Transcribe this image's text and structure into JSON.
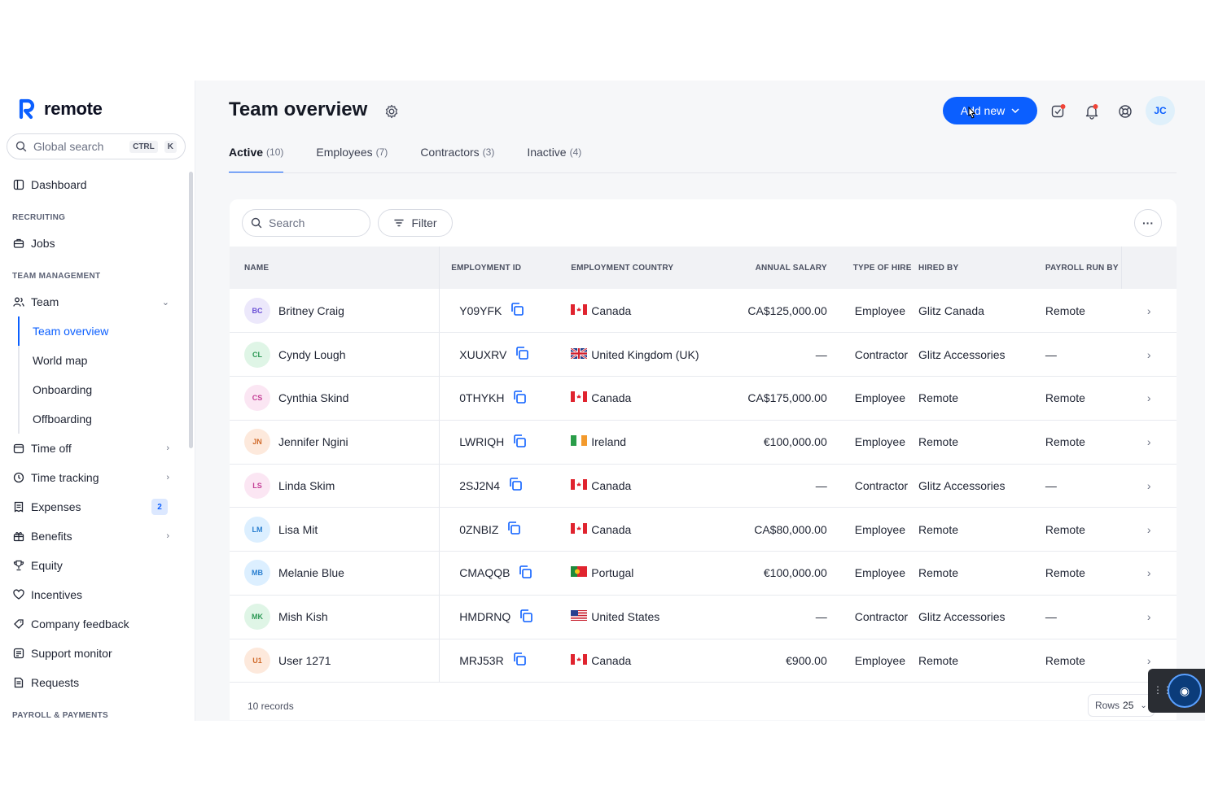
{
  "brand": {
    "name": "remote"
  },
  "global_search": {
    "placeholder": "Global search",
    "shortcut_ctrl": "CTRL",
    "shortcut_key": "K"
  },
  "sidebar": {
    "dashboard": "Dashboard",
    "section_recruiting": "RECRUITING",
    "jobs": "Jobs",
    "section_team": "TEAM MANAGEMENT",
    "team": "Team",
    "team_sub": [
      "Team overview",
      "World map",
      "Onboarding",
      "Offboarding"
    ],
    "time_off": "Time off",
    "time_tracking": "Time tracking",
    "expenses": "Expenses",
    "expenses_badge": "2",
    "benefits": "Benefits",
    "equity": "Equity",
    "incentives": "Incentives",
    "company_feedback": "Company feedback",
    "support_monitor": "Support monitor",
    "requests": "Requests",
    "section_payroll": "PAYROLL & PAYMENTS"
  },
  "header": {
    "title": "Team overview",
    "add_new": "Add new",
    "user_initials": "JC"
  },
  "tabs": [
    {
      "label": "Active",
      "count": "(10)"
    },
    {
      "label": "Employees",
      "count": "(7)"
    },
    {
      "label": "Contractors",
      "count": "(3)"
    },
    {
      "label": "Inactive",
      "count": "(4)"
    }
  ],
  "toolbar": {
    "search_placeholder": "Search",
    "filter_label": "Filter",
    "more_label": "···"
  },
  "table": {
    "headers": [
      "NAME",
      "EMPLOYMENT ID",
      "EMPLOYMENT COUNTRY",
      "ANNUAL SALARY",
      "TYPE OF HIRE",
      "HIRED BY",
      "PAYROLL RUN BY"
    ],
    "rows": [
      {
        "initials": "BC",
        "name": "Britney Craig",
        "id": "Y09YFK",
        "country": "Canada",
        "flag": "ca",
        "salary": "CA$125,000.00",
        "type": "Employee",
        "hired_by": "Glitz Canada",
        "payroll": "Remote",
        "av_bg": "#ece8fb",
        "av_fg": "#6a4fd6"
      },
      {
        "initials": "CL",
        "name": "Cyndy Lough",
        "id": "XUUXRV",
        "country": "United Kingdom (UK)",
        "flag": "uk",
        "salary": "—",
        "type": "Contractor",
        "hired_by": "Glitz Accessories",
        "payroll": "—",
        "av_bg": "#dff5e6",
        "av_fg": "#2f9a57"
      },
      {
        "initials": "CS",
        "name": "Cynthia Skind",
        "id": "0THYKH",
        "country": "Canada",
        "flag": "ca",
        "salary": "CA$175,000.00",
        "type": "Employee",
        "hired_by": "Remote",
        "payroll": "Remote",
        "av_bg": "#fbe6f3",
        "av_fg": "#c43f96"
      },
      {
        "initials": "JN",
        "name": "Jennifer Ngini",
        "id": "LWRIQH",
        "country": "Ireland",
        "flag": "ie",
        "salary": "€100,000.00",
        "type": "Employee",
        "hired_by": "Remote",
        "payroll": "Remote",
        "av_bg": "#fde9dc",
        "av_fg": "#d06a2a"
      },
      {
        "initials": "LS",
        "name": "Linda Skim",
        "id": "2SJ2N4",
        "country": "Canada",
        "flag": "ca",
        "salary": "—",
        "type": "Contractor",
        "hired_by": "Glitz Accessories",
        "payroll": "—",
        "av_bg": "#fbe6f3",
        "av_fg": "#c43f96"
      },
      {
        "initials": "LM",
        "name": "Lisa Mit",
        "id": "0ZNBIZ",
        "country": "Canada",
        "flag": "ca",
        "salary": "CA$80,000.00",
        "type": "Employee",
        "hired_by": "Remote",
        "payroll": "Remote",
        "av_bg": "#dcefff",
        "av_fg": "#2a7fd0"
      },
      {
        "initials": "MB",
        "name": "Melanie Blue",
        "id": "CMAQQB",
        "country": "Portugal",
        "flag": "pt",
        "salary": "€100,000.00",
        "type": "Employee",
        "hired_by": "Remote",
        "payroll": "Remote",
        "av_bg": "#dcefff",
        "av_fg": "#2a7fd0"
      },
      {
        "initials": "MK",
        "name": "Mish Kish",
        "id": "HMDRNQ",
        "country": "United States",
        "flag": "us",
        "salary": "—",
        "type": "Contractor",
        "hired_by": "Glitz Accessories",
        "payroll": "—",
        "av_bg": "#dff5e6",
        "av_fg": "#2f9a57"
      },
      {
        "initials": "U1",
        "name": "User 1271",
        "id": "MRJ53R",
        "country": "Canada",
        "flag": "ca",
        "salary": "€900.00",
        "type": "Employee",
        "hired_by": "Remote",
        "payroll": "Remote",
        "av_bg": "#fde9dc",
        "av_fg": "#d06a2a"
      }
    ]
  },
  "footer": {
    "records": "10 records",
    "rows_label": "Rows",
    "rows_value": "25"
  },
  "colors": {
    "accent": "#0b5fff",
    "notification": "#f04438"
  }
}
